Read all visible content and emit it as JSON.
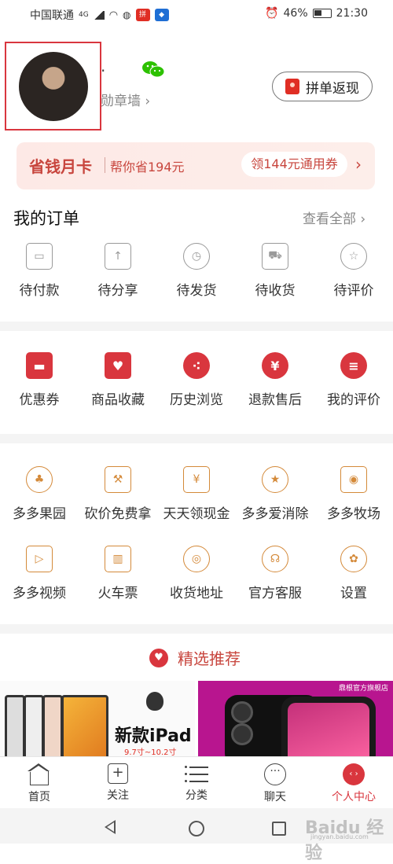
{
  "status_bar": {
    "carrier": "中国联通",
    "network": "4G",
    "battery": "46%",
    "time": "21:30",
    "app_badge_1": "拼"
  },
  "profile": {
    "username": "·",
    "badge_wall": "勋章墙 ›",
    "pdd_button": "拼单返现"
  },
  "money_card": {
    "title": "省钱月卡",
    "subtitle": "帮你省194元",
    "button": "领144元通用券",
    "arrow": "›"
  },
  "orders": {
    "title": "我的订单",
    "view_all": "查看全部 ›",
    "items": [
      {
        "label": "待付款"
      },
      {
        "label": "待分享"
      },
      {
        "label": "待发货"
      },
      {
        "label": "待收货"
      },
      {
        "label": "待评价"
      }
    ]
  },
  "services": {
    "items": [
      {
        "label": "优惠券",
        "glyph": "▬"
      },
      {
        "label": "商品收藏",
        "glyph": "♥"
      },
      {
        "label": "历史浏览",
        "glyph": "⁖"
      },
      {
        "label": "退款售后",
        "glyph": "¥"
      },
      {
        "label": "我的评价",
        "glyph": "≡"
      }
    ]
  },
  "features_1": {
    "items": [
      {
        "label": "多多果园",
        "glyph": "♣"
      },
      {
        "label": "砍价免费拿",
        "glyph": "⚒"
      },
      {
        "label": "天天领现金",
        "glyph": "¥"
      },
      {
        "label": "多多爱消除",
        "glyph": "★"
      },
      {
        "label": "多多牧场",
        "glyph": "◉"
      }
    ]
  },
  "features_2": {
    "items": [
      {
        "label": "多多视频",
        "glyph": "▷"
      },
      {
        "label": "火车票",
        "glyph": "▥"
      },
      {
        "label": "收货地址",
        "glyph": "◎"
      },
      {
        "label": "官方客服",
        "glyph": "☊"
      },
      {
        "label": "设置",
        "glyph": "✿"
      }
    ]
  },
  "recommend": {
    "title": "精选推荐",
    "banner_left": {
      "title": "新款iPad",
      "sub": "9.7寸~10.2寸"
    },
    "banner_right": {
      "store": "鼎根官方旗舰店"
    }
  },
  "bottom_nav": {
    "items": [
      {
        "label": "首页"
      },
      {
        "label": "关注"
      },
      {
        "label": "分类"
      },
      {
        "label": "聊天"
      },
      {
        "label": "个人中心"
      }
    ]
  },
  "watermark": {
    "text": "Baidu 经验",
    "sub": "jingyan.baidu.com"
  },
  "colors": {
    "accent": "#d9363e",
    "feature_icon": "#d48a3a",
    "card_bg": "#fde9e6"
  }
}
